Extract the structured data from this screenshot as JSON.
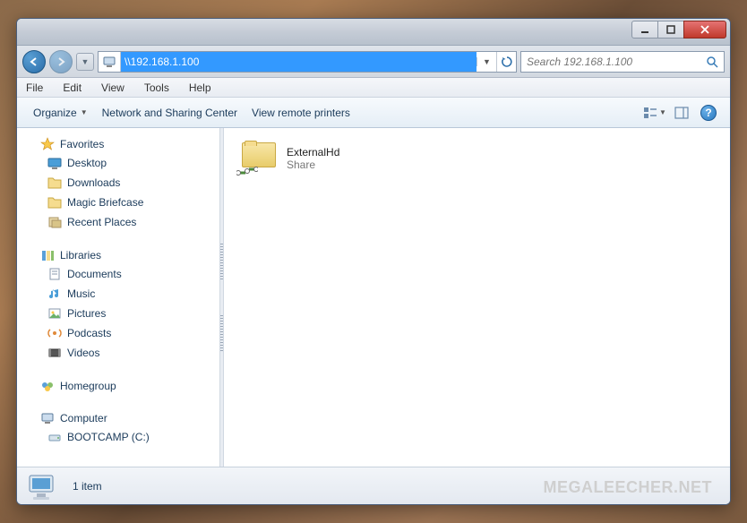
{
  "titlebar": {
    "min_tip": "Minimize",
    "max_tip": "Maximize",
    "close_tip": "Close"
  },
  "address": {
    "path": "\\\\192.168.1.100",
    "search_placeholder": "Search 192.168.1.100"
  },
  "menubar": {
    "file": "File",
    "edit": "Edit",
    "view": "View",
    "tools": "Tools",
    "help": "Help"
  },
  "cmdbar": {
    "organize": "Organize",
    "network_center": "Network and Sharing Center",
    "remote_printers": "View remote printers"
  },
  "sidebar": {
    "favorites": {
      "label": "Favorites",
      "items": [
        {
          "label": "Desktop"
        },
        {
          "label": "Downloads"
        },
        {
          "label": "Magic Briefcase"
        },
        {
          "label": "Recent Places"
        }
      ]
    },
    "libraries": {
      "label": "Libraries",
      "items": [
        {
          "label": "Documents"
        },
        {
          "label": "Music"
        },
        {
          "label": "Pictures"
        },
        {
          "label": "Podcasts"
        },
        {
          "label": "Videos"
        }
      ]
    },
    "homegroup": {
      "label": "Homegroup"
    },
    "computer": {
      "label": "Computer",
      "items": [
        {
          "label": "BOOTCAMP (C:)"
        }
      ]
    }
  },
  "main": {
    "items": [
      {
        "name": "ExternalHd",
        "type": "Share"
      }
    ]
  },
  "statusbar": {
    "count_text": "1 item"
  },
  "watermark": "MEGALEECHER.NET"
}
